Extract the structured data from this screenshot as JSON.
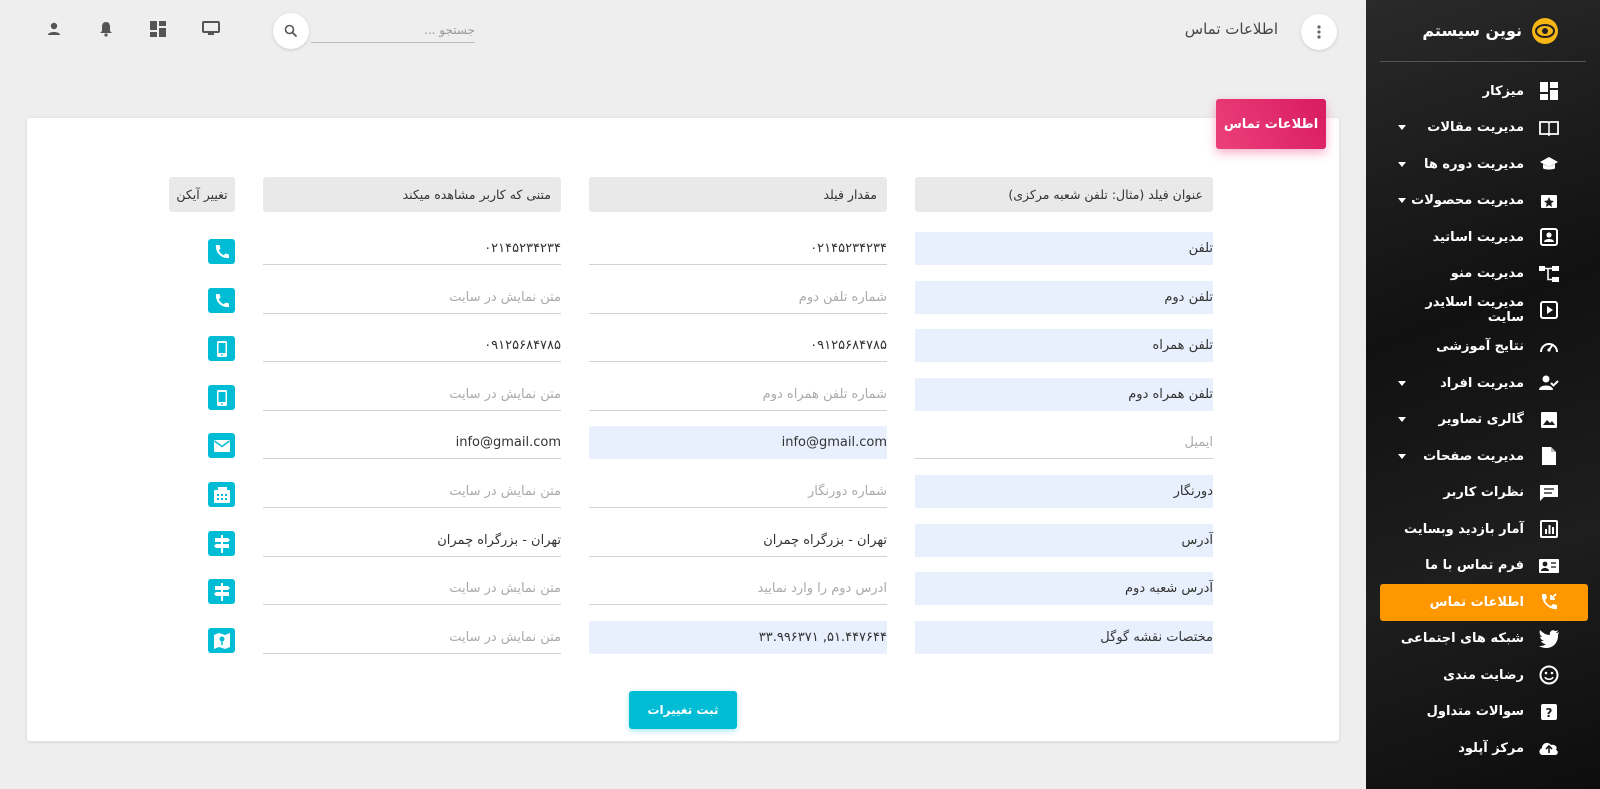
{
  "brand": {
    "name": "نوین سیستم"
  },
  "sidebar": {
    "items": [
      {
        "label": "میزکار",
        "icon": "dashboard-icon",
        "has_sub": false
      },
      {
        "label": "مدیریت مقالات",
        "icon": "book-icon",
        "has_sub": true
      },
      {
        "label": "مدیریت دوره ها",
        "icon": "graduation-cap-icon",
        "has_sub": true
      },
      {
        "label": "مدیریت محصولات",
        "icon": "star-box-icon",
        "has_sub": true
      },
      {
        "label": "مدیریت اساتید",
        "icon": "person-card-icon",
        "has_sub": false
      },
      {
        "label": "مدیریت منو",
        "icon": "menu-tree-icon",
        "has_sub": false
      },
      {
        "label": "مدیریت اسلایدر سایت",
        "icon": "slider-icon",
        "has_sub": false
      },
      {
        "label": "نتایج آموزشی",
        "icon": "gauge-icon",
        "has_sub": false
      },
      {
        "label": "مدیریت افراد",
        "icon": "person-check-icon",
        "has_sub": true
      },
      {
        "label": "گالری تصاویر",
        "icon": "image-icon",
        "has_sub": true
      },
      {
        "label": "مدیریت صفحات",
        "icon": "page-icon",
        "has_sub": true
      },
      {
        "label": "نظرات کاربر",
        "icon": "comment-icon",
        "has_sub": false
      },
      {
        "label": "آمار بازدید وبسایت",
        "icon": "chart-icon",
        "has_sub": false
      },
      {
        "label": "فرم تماس با ما",
        "icon": "contact-card-icon",
        "has_sub": false
      },
      {
        "label": "اطلاعات تماس",
        "icon": "phone-callback-icon",
        "has_sub": false,
        "active": true
      },
      {
        "label": "شبکه های اجتماعی",
        "icon": "twitter-icon",
        "has_sub": false
      },
      {
        "label": "رضایت مندی",
        "icon": "smiley-icon",
        "has_sub": false
      },
      {
        "label": "سوالات متداول",
        "icon": "question-icon",
        "has_sub": false
      },
      {
        "label": "مرکز آپلود",
        "icon": "cloud-upload-icon",
        "has_sub": false
      }
    ]
  },
  "topbar": {
    "title": "اطلاعات تماس",
    "search_placeholder": "جستجو ..."
  },
  "card": {
    "title": "اطلاعات تماس",
    "headers": {
      "field_title": "عنوان فیلد (مثال: تلفن شعبه مرکزی)",
      "field_value": "مقدار فیلد",
      "display_text": "متنی که کاربر مشاهده میکند",
      "change_icon": "تغییر آیکن"
    },
    "rows": [
      {
        "title": "تلفن",
        "title_filled": true,
        "value": "۰۲۱۴۵۲۳۴۲۳۴",
        "value_placeholder": "",
        "value_filled": false,
        "display": "۰۲۱۴۵۲۳۴۲۳۴",
        "display_placeholder": "",
        "icon": "phone-icon"
      },
      {
        "title": "تلفن دوم",
        "title_filled": true,
        "value": "",
        "value_placeholder": "شماره تلفن دوم",
        "value_filled": false,
        "display": "",
        "display_placeholder": "متن نمایش در سایت",
        "icon": "phone-icon"
      },
      {
        "title": "تلفن همراه",
        "title_filled": true,
        "value": "۰۹۱۲۵۶۸۴۷۸۵",
        "value_placeholder": "",
        "value_filled": false,
        "display": "۰۹۱۲۵۶۸۴۷۸۵",
        "display_placeholder": "",
        "icon": "mobile-icon"
      },
      {
        "title": "تلفن همراه دوم",
        "title_filled": true,
        "value": "",
        "value_placeholder": "شماره تلفن همراه دوم",
        "value_filled": false,
        "display": "",
        "display_placeholder": "متن نمایش در سایت",
        "icon": "mobile-icon"
      },
      {
        "title": "",
        "title_placeholder": "ایمیل",
        "title_filled": false,
        "value": "info@gmail.com",
        "value_placeholder": "",
        "value_filled": true,
        "display": "info@gmail.com",
        "display_placeholder": "",
        "icon": "email-icon"
      },
      {
        "title": "دورنگار",
        "title_filled": true,
        "value": "",
        "value_placeholder": "شماره دورنگار",
        "value_filled": false,
        "display": "",
        "display_placeholder": "متن نمایش در سایت",
        "icon": "fax-icon"
      },
      {
        "title": "آدرس",
        "title_filled": true,
        "value": "تهران - بزرگراه چمران",
        "value_placeholder": "",
        "value_filled": false,
        "display": "تهران - بزرگراه چمران",
        "display_placeholder": "",
        "icon": "signpost-icon"
      },
      {
        "title": "آدرس شعبه دوم",
        "title_filled": true,
        "value": "",
        "value_placeholder": "ادرس دوم را وارد نمایید",
        "value_filled": false,
        "display": "",
        "display_placeholder": "متن نمایش در سایت",
        "icon": "signpost-icon"
      },
      {
        "title": "مختصات نقشه گوگل",
        "title_filled": true,
        "value": "۵۱.۴۴۷۶۴۴, ۳۳.۹۹۶۳۷۱",
        "value_placeholder": "",
        "value_filled": true,
        "display": "",
        "display_placeholder": "متن نمایش در سایت",
        "icon": "map-icon"
      }
    ],
    "submit_label": "ثبت تغییرات"
  },
  "colors": {
    "accent_active": "#ff9800",
    "header_pink": "#e91e63",
    "cyan": "#00bcd4",
    "logo_yellow": "#f6b615"
  }
}
